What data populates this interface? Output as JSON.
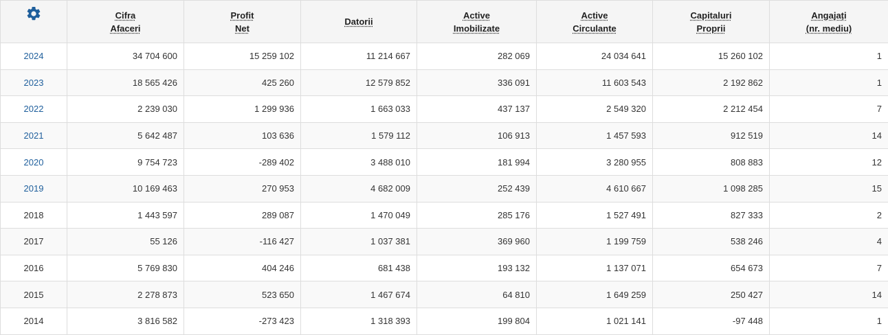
{
  "colors": {
    "link": "#1f5f9c",
    "gear": "#1f5f9c",
    "header_bg": "#f5f5f5",
    "border": "#dddddd"
  },
  "settings_icon": "gear-icon",
  "headers": [
    {
      "key": "cifra-afaceri",
      "line1": "Cifra",
      "line2": "Afaceri"
    },
    {
      "key": "profit-net",
      "line1": "Profit",
      "line2": "Net"
    },
    {
      "key": "datorii",
      "line1": "Datorii",
      "line2": ""
    },
    {
      "key": "active-imobilizate",
      "line1": "Active",
      "line2": "Imobilizate"
    },
    {
      "key": "active-circulante",
      "line1": "Active",
      "line2": "Circulante"
    },
    {
      "key": "capitaluri-proprii",
      "line1": "Capitaluri",
      "line2": "Proprii"
    },
    {
      "key": "angajati",
      "line1": "Angajați",
      "line2": "(nr. mediu)"
    }
  ],
  "rows": [
    {
      "year": "2024",
      "link": true,
      "values": [
        "34 704 600",
        "15 259 102",
        "11 214 667",
        "282 069",
        "24 034 641",
        "15 260 102",
        "1"
      ]
    },
    {
      "year": "2023",
      "link": true,
      "values": [
        "18 565 426",
        "425 260",
        "12 579 852",
        "336 091",
        "11 603 543",
        "2 192 862",
        "1"
      ]
    },
    {
      "year": "2022",
      "link": true,
      "values": [
        "2 239 030",
        "1 299 936",
        "1 663 033",
        "437 137",
        "2 549 320",
        "2 212 454",
        "7"
      ]
    },
    {
      "year": "2021",
      "link": true,
      "values": [
        "5 642 487",
        "103 636",
        "1 579 112",
        "106 913",
        "1 457 593",
        "912 519",
        "14"
      ]
    },
    {
      "year": "2020",
      "link": true,
      "values": [
        "9 754 723",
        "-289 402",
        "3 488 010",
        "181 994",
        "3 280 955",
        "808 883",
        "12"
      ]
    },
    {
      "year": "2019",
      "link": true,
      "values": [
        "10 169 463",
        "270 953",
        "4 682 009",
        "252 439",
        "4 610 667",
        "1 098 285",
        "15"
      ]
    },
    {
      "year": "2018",
      "link": false,
      "values": [
        "1 443 597",
        "289 087",
        "1 470 049",
        "285 176",
        "1 527 491",
        "827 333",
        "2"
      ]
    },
    {
      "year": "2017",
      "link": false,
      "values": [
        "55 126",
        "-116 427",
        "1 037 381",
        "369 960",
        "1 199 759",
        "538 246",
        "4"
      ]
    },
    {
      "year": "2016",
      "link": false,
      "values": [
        "5 769 830",
        "404 246",
        "681 438",
        "193 132",
        "1 137 071",
        "654 673",
        "7"
      ]
    },
    {
      "year": "2015",
      "link": false,
      "values": [
        "2 278 873",
        "523 650",
        "1 467 674",
        "64 810",
        "1 649 259",
        "250 427",
        "14"
      ]
    },
    {
      "year": "2014",
      "link": false,
      "values": [
        "3 816 582",
        "-273 423",
        "1 318 393",
        "199 804",
        "1 021 141",
        "-97 448",
        "1"
      ]
    }
  ]
}
